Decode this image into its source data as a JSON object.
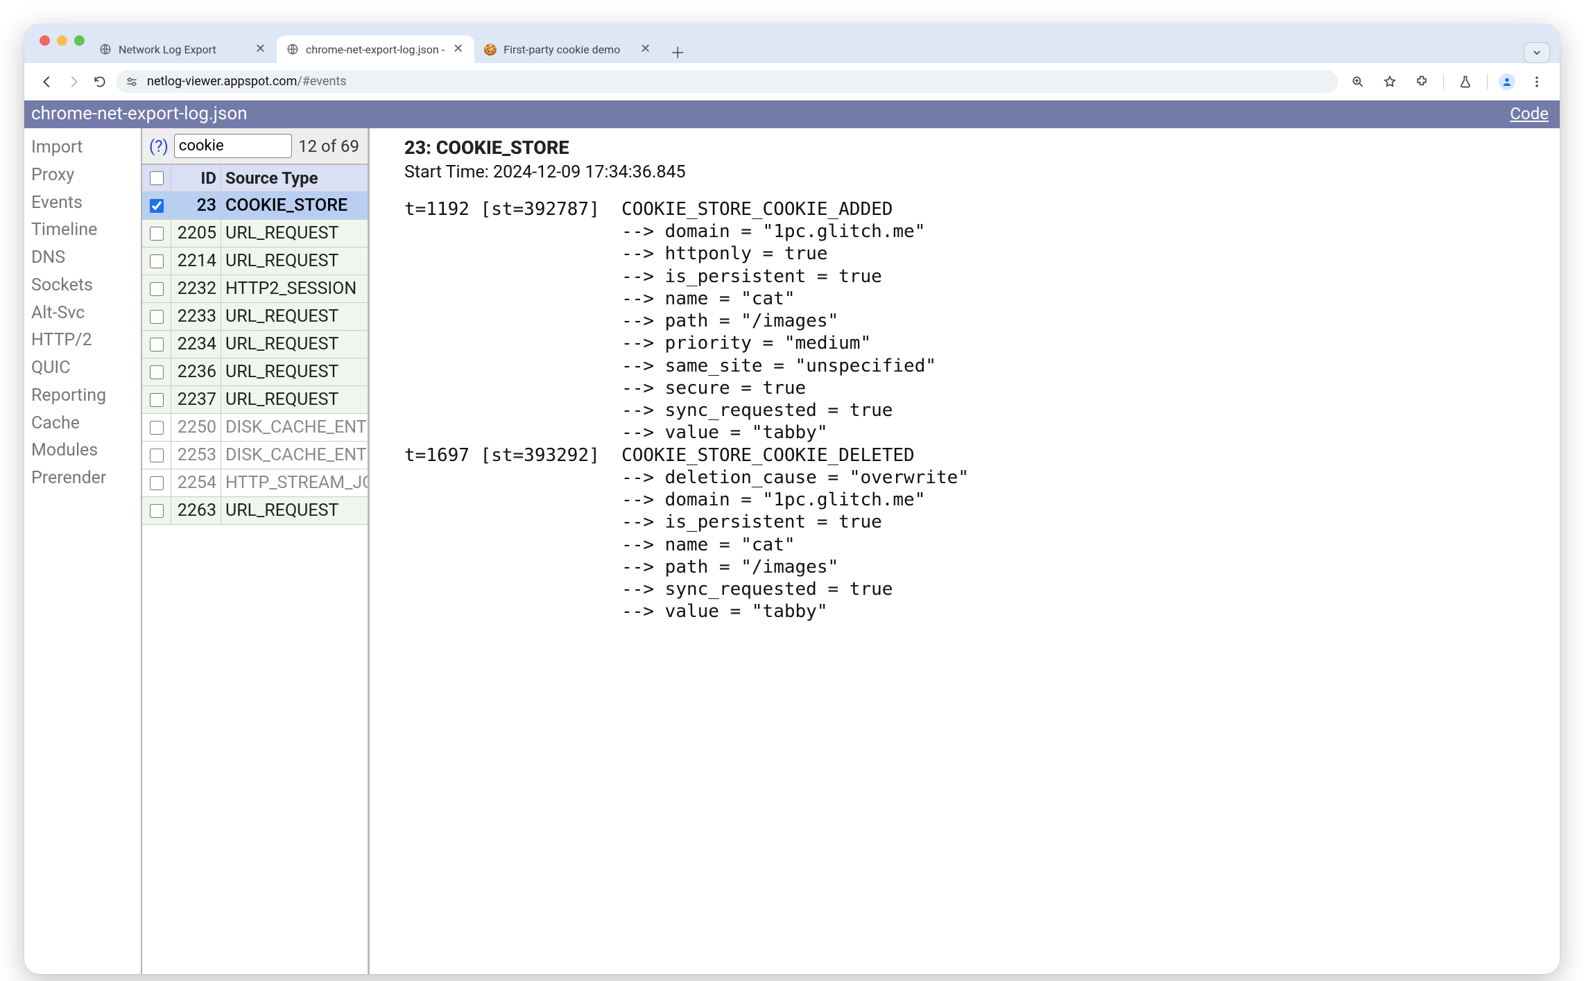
{
  "browser": {
    "tabs": [
      {
        "title": "Network Log Export",
        "active": false,
        "icon": "globe"
      },
      {
        "title": "chrome-net-export-log.json - ",
        "active": true,
        "icon": "globe"
      },
      {
        "title": "First-party cookie demo",
        "active": false,
        "icon": "cookie"
      }
    ],
    "url_host": "netlog-viewer.appspot.com",
    "url_rest": "/#events"
  },
  "appbar": {
    "title": "chrome-net-export-log.json",
    "code": "Code"
  },
  "sidebar": {
    "items": [
      "Import",
      "Proxy",
      "Events",
      "Timeline",
      "DNS",
      "Sockets",
      "Alt-Svc",
      "HTTP/2",
      "QUIC",
      "Reporting",
      "Cache",
      "Modules",
      "Prerender"
    ]
  },
  "filter": {
    "help": "(?)",
    "value": "cookie",
    "count": "12 of 69"
  },
  "table": {
    "header": {
      "id": "ID",
      "src": "Source Type"
    },
    "rows": [
      {
        "id": "23",
        "src": "COOKIE_STORE",
        "variant": "selected",
        "checked": true
      },
      {
        "id": "2205",
        "src": "URL_REQUEST",
        "variant": "normal",
        "checked": false
      },
      {
        "id": "2214",
        "src": "URL_REQUEST",
        "variant": "normal",
        "checked": false
      },
      {
        "id": "2232",
        "src": "HTTP2_SESSION",
        "variant": "normal",
        "checked": false
      },
      {
        "id": "2233",
        "src": "URL_REQUEST",
        "variant": "normal",
        "checked": false
      },
      {
        "id": "2234",
        "src": "URL_REQUEST",
        "variant": "normal",
        "checked": false
      },
      {
        "id": "2236",
        "src": "URL_REQUEST",
        "variant": "normal",
        "checked": false
      },
      {
        "id": "2237",
        "src": "URL_REQUEST",
        "variant": "normal",
        "checked": false
      },
      {
        "id": "2250",
        "src": "DISK_CACHE_ENTR",
        "variant": "grey",
        "checked": false
      },
      {
        "id": "2253",
        "src": "DISK_CACHE_ENTR",
        "variant": "grey",
        "checked": false
      },
      {
        "id": "2254",
        "src": "HTTP_STREAM_JO",
        "variant": "grey",
        "checked": false
      },
      {
        "id": "2263",
        "src": "URL_REQUEST",
        "variant": "normal",
        "checked": false
      }
    ]
  },
  "details": {
    "header_id": "23: COOKIE_STORE",
    "header_time": "Start Time: 2024-12-09 17:34:36.845",
    "log": "t=1192 [st=392787]  COOKIE_STORE_COOKIE_ADDED\n                    --> domain = \"1pc.glitch.me\"\n                    --> httponly = true\n                    --> is_persistent = true\n                    --> name = \"cat\"\n                    --> path = \"/images\"\n                    --> priority = \"medium\"\n                    --> same_site = \"unspecified\"\n                    --> secure = true\n                    --> sync_requested = true\n                    --> value = \"tabby\"\nt=1697 [st=393292]  COOKIE_STORE_COOKIE_DELETED\n                    --> deletion_cause = \"overwrite\"\n                    --> domain = \"1pc.glitch.me\"\n                    --> is_persistent = true\n                    --> name = \"cat\"\n                    --> path = \"/images\"\n                    --> sync_requested = true\n                    --> value = \"tabby\""
  }
}
